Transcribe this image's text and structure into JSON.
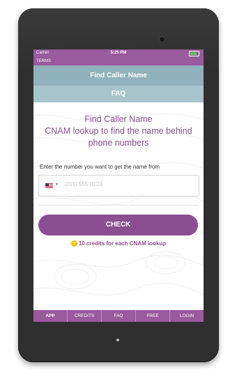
{
  "status_bar": {
    "carrier": "Carrier",
    "time": "5:25 PM",
    "battery_level": 0.8
  },
  "terms_label": "TERMS",
  "menu": {
    "find_caller_name": "Find Caller Name",
    "faq": "FAQ"
  },
  "main": {
    "title": "Find Caller Name",
    "subtitle_line1": "CNAM lookup to find the name behind",
    "subtitle_line2": "phone numbers",
    "input_label": "Enter the number you want to get the name from",
    "phone_placeholder": "(201) 555-0123",
    "country_flag": "US-flag-icon",
    "check_button": "CHECK",
    "credits_note": "10 credits for each CNAM lookup"
  },
  "bottom_nav": [
    "APP",
    "CREDITS",
    "FAQ",
    "FREE",
    "LOGIN"
  ],
  "colors": {
    "brand_purple": "#8b4f91",
    "bar_purple": "#9a5a9e",
    "menu_blue": "#91b2bd",
    "menu_blue_light": "#a8c4cc",
    "coin_yellow": "#f2c200"
  }
}
